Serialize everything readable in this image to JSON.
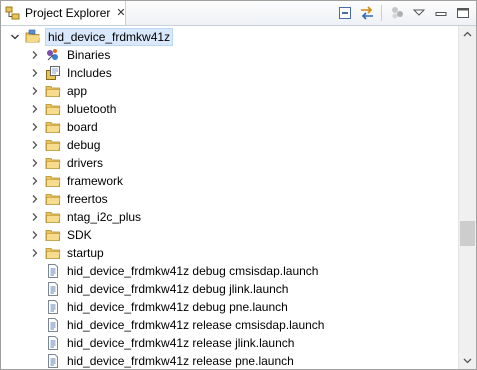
{
  "view": {
    "title": "Project Explorer",
    "close_glyph": "✕",
    "toolbar": [
      {
        "name": "collapse-all-icon"
      },
      {
        "name": "link-with-editor-icon"
      },
      {
        "name": "filter-icon"
      },
      {
        "name": "view-menu-icon"
      },
      {
        "name": "minimize-icon"
      },
      {
        "name": "maximize-icon"
      }
    ]
  },
  "tree": {
    "project": {
      "label": "hid_device_frdmkw41z",
      "expanded": true,
      "selected": true
    },
    "items": [
      {
        "label": "Binaries",
        "type": "binaries",
        "expandable": true
      },
      {
        "label": "Includes",
        "type": "includes",
        "expandable": true
      },
      {
        "label": "app",
        "type": "folder",
        "expandable": true
      },
      {
        "label": "bluetooth",
        "type": "folder",
        "expandable": true
      },
      {
        "label": "board",
        "type": "folder",
        "expandable": true
      },
      {
        "label": "debug",
        "type": "folder",
        "expandable": true
      },
      {
        "label": "drivers",
        "type": "folder",
        "expandable": true
      },
      {
        "label": "framework",
        "type": "folder",
        "expandable": true
      },
      {
        "label": "freertos",
        "type": "folder",
        "expandable": true
      },
      {
        "label": "ntag_i2c_plus",
        "type": "folder",
        "expandable": true
      },
      {
        "label": "SDK",
        "type": "folder",
        "expandable": true
      },
      {
        "label": "startup",
        "type": "folder",
        "expandable": true
      },
      {
        "label": "hid_device_frdmkw41z debug cmsisdap.launch",
        "type": "file",
        "expandable": false
      },
      {
        "label": "hid_device_frdmkw41z debug jlink.launch",
        "type": "file",
        "expandable": false
      },
      {
        "label": "hid_device_frdmkw41z debug pne.launch",
        "type": "file",
        "expandable": false
      },
      {
        "label": "hid_device_frdmkw41z release cmsisdap.launch",
        "type": "file",
        "expandable": false
      },
      {
        "label": "hid_device_frdmkw41z release jlink.launch",
        "type": "file",
        "expandable": false
      },
      {
        "label": "hid_device_frdmkw41z release pne.launch",
        "type": "file",
        "expandable": false
      }
    ]
  },
  "colors": {
    "folder": "#e8c25a",
    "selection": "#d9e8fb"
  }
}
